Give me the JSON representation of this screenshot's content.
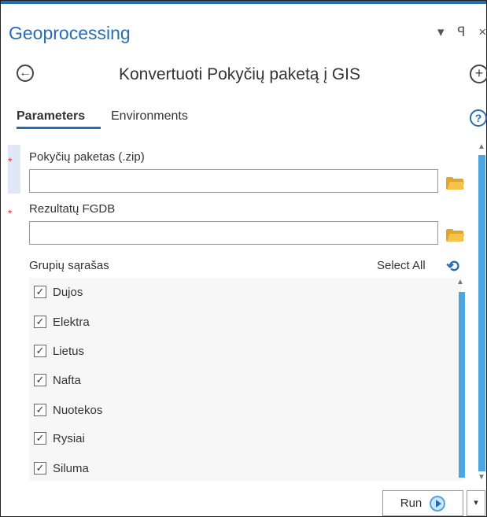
{
  "header": {
    "title": "Geoprocessing",
    "pin_label": "▾ ꟼ ×",
    "tool_title": "Konvertuoti Pokyčių paketą į GIS",
    "back_glyph": "←",
    "add_glyph": "+"
  },
  "tabs": [
    {
      "label": "Parameters",
      "active": true
    },
    {
      "label": "Environments",
      "active": false
    }
  ],
  "help_glyph": "?",
  "params": {
    "package": {
      "label": "Pokyčių paketas (.zip)",
      "value": "",
      "required": true
    },
    "fgdb": {
      "label": "Rezultatų FGDB",
      "value": "",
      "required": true
    },
    "required_marker": "*"
  },
  "groups": {
    "label": "Grupių sąrašas",
    "select_all": "Select All",
    "reset_glyph": "⟲",
    "check_glyph": "✓",
    "items": [
      {
        "label": "Dujos",
        "checked": true
      },
      {
        "label": "Elektra",
        "checked": true
      },
      {
        "label": "Lietus",
        "checked": true
      },
      {
        "label": "Nafta",
        "checked": true
      },
      {
        "label": "Nuotekos",
        "checked": true
      },
      {
        "label": "Rysiai",
        "checked": true
      },
      {
        "label": "Siluma",
        "checked": true
      }
    ]
  },
  "footer": {
    "run_label": "Run",
    "dropdown_glyph": "▾"
  },
  "colors": {
    "accent": "#1f6fb7",
    "scroll": "#4ea6e0",
    "required": "#d04040",
    "folder": "#e0a52a"
  }
}
